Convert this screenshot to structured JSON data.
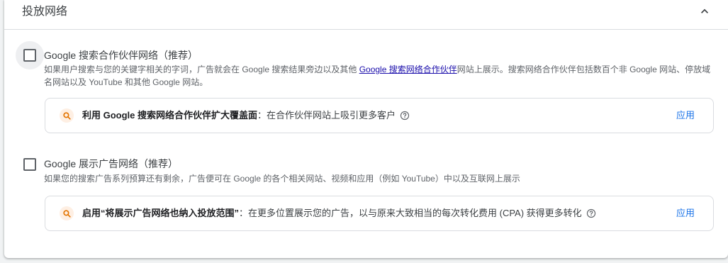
{
  "header": {
    "title": "投放网络",
    "collapse_icon": "chevron-up-icon"
  },
  "search_partners": {
    "title": "Google 搜索合作伙伴网络（推荐）",
    "checked": false,
    "desc_before": "如果用户搜索与您的关键字相关的字词，广告就会在 Google 搜索结果旁边以及其他 ",
    "desc_link": "Google 搜索网络合作伙伴",
    "desc_after": "网站上展示。搜索网络合作伙伴包括数百个非 Google 网站、停放域名网站以及 YouTube 和其他 Google 网站。",
    "rec_bold": "利用 Google 搜索网络合作伙伴扩大覆盖面",
    "rec_text": "：在合作伙伴网站上吸引更多客户",
    "apply_label": "应用"
  },
  "display_network": {
    "title": "Google 展示广告网络（推荐）",
    "checked": false,
    "desc": "如果您的搜索广告系列预算还有剩余，广告便可在 Google 的各个相关网站、视频和应用（例如 YouTube）中以及互联网上展示",
    "rec_bold": "启用“将展示广告网络也纳入投放范围”",
    "rec_text": "：在更多位置展示您的广告，以与原来大致相当的每次转化费用 (CPA) 获得更多转化",
    "apply_label": "应用"
  },
  "colors": {
    "accent": "#1a73e8",
    "link": "#1a0dab",
    "rec_icon_bg": "#feefe3",
    "rec_icon_fg": "#e37400"
  }
}
